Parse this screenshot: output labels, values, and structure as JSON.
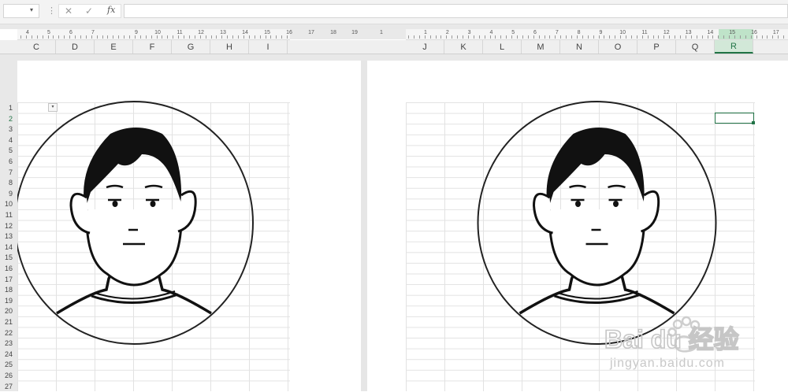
{
  "formula_bar": {
    "name_box_value": "",
    "cancel_icon": "close-icon",
    "confirm_icon": "check-icon",
    "fx_label": "fx",
    "formula_value": ""
  },
  "ruler": {
    "left_numbers": [
      "4",
      "5",
      "6",
      "7",
      "9",
      "10",
      "11",
      "12",
      "13",
      "14",
      "15",
      "16",
      "17",
      "18",
      "19",
      "1"
    ],
    "right_numbers": [
      "1",
      "2",
      "3",
      "4",
      "5",
      "6",
      "7",
      "8",
      "9",
      "10",
      "11",
      "12",
      "13",
      "14",
      "15",
      "16",
      "17"
    ]
  },
  "columns": {
    "left": [
      "C",
      "D",
      "E",
      "F",
      "G",
      "H",
      "I"
    ],
    "right": [
      "J",
      "K",
      "L",
      "M",
      "N",
      "O",
      "P",
      "Q",
      "R"
    ],
    "active": "R"
  },
  "rows": [
    "1",
    "2",
    "3",
    "4",
    "5",
    "6",
    "7",
    "8",
    "9",
    "10",
    "11",
    "12",
    "13",
    "14",
    "15",
    "16",
    "17",
    "18",
    "19",
    "20",
    "21",
    "22",
    "23",
    "24",
    "25",
    "26",
    "27"
  ],
  "active_row": "2",
  "watermark": {
    "brand": "Bai du 经验",
    "url": "jingyan.baidu.com"
  },
  "colors": {
    "accent": "#217346",
    "grid": "#e2e2e2",
    "header_bg": "#efefef"
  }
}
